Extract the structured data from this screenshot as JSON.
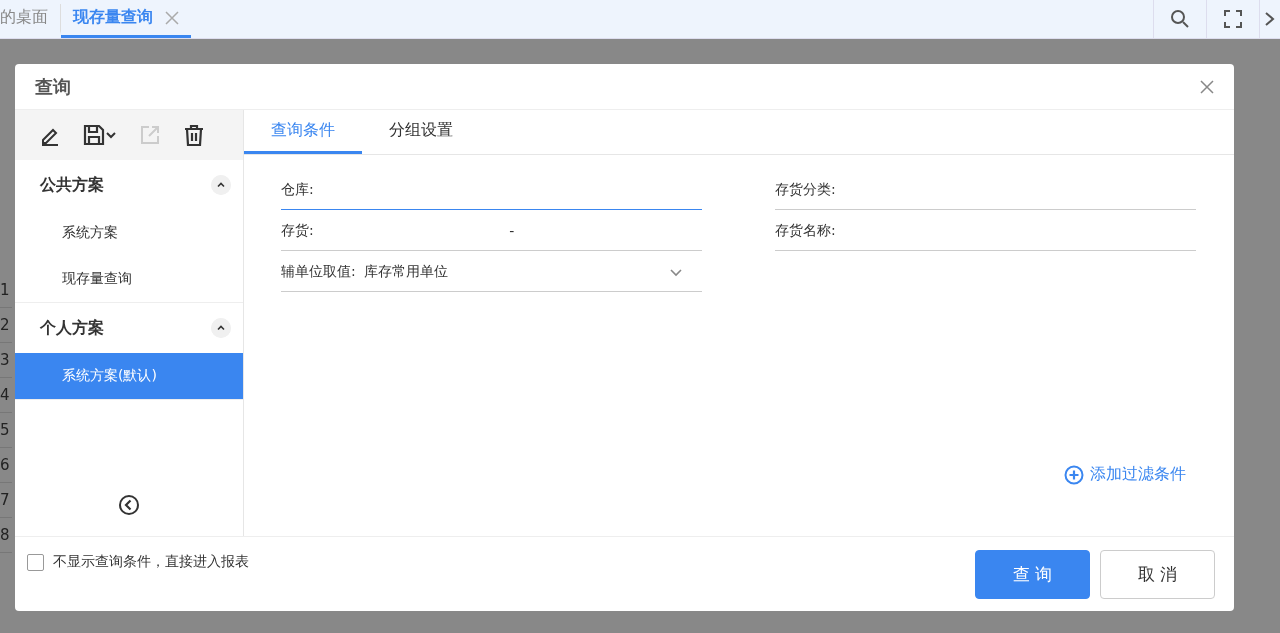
{
  "tabs": [
    {
      "label": "的桌面",
      "selected": false,
      "closable": false
    },
    {
      "label": "现存量查询",
      "selected": true,
      "closable": true
    }
  ],
  "background_rows": [
    "1",
    "2",
    "3",
    "4",
    "5",
    "6",
    "7",
    "8"
  ],
  "dialog": {
    "title": "查询",
    "sidebar": {
      "groups": [
        {
          "title": "公共方案",
          "expanded": true,
          "items": [
            {
              "label": "系统方案",
              "selected": false
            },
            {
              "label": "现存量查询",
              "selected": false
            }
          ]
        },
        {
          "title": "个人方案",
          "expanded": true,
          "items": [
            {
              "label": "系统方案(默认)",
              "selected": true
            }
          ]
        }
      ]
    },
    "tabs": [
      {
        "label": "查询条件",
        "selected": true
      },
      {
        "label": "分组设置",
        "selected": false
      }
    ],
    "fields": [
      {
        "kind": "text",
        "label": "仓库:",
        "focused": true
      },
      {
        "kind": "text",
        "label": "存货分类:",
        "focused": false
      },
      {
        "kind": "range",
        "label": "存货:",
        "separator": "-",
        "focused": false
      },
      {
        "kind": "text",
        "label": "存货名称:",
        "focused": false
      },
      {
        "kind": "select",
        "label": "辅单位取值:",
        "value": "库存常用单位",
        "focused": false
      }
    ],
    "add_filter": "添加过滤条件",
    "skip_option": {
      "label": "不显示查询条件，直接进入报表",
      "checked": false
    },
    "buttons": [
      {
        "label": "查 询",
        "kind": "primary"
      },
      {
        "label": "取 消",
        "kind": "default"
      }
    ]
  }
}
